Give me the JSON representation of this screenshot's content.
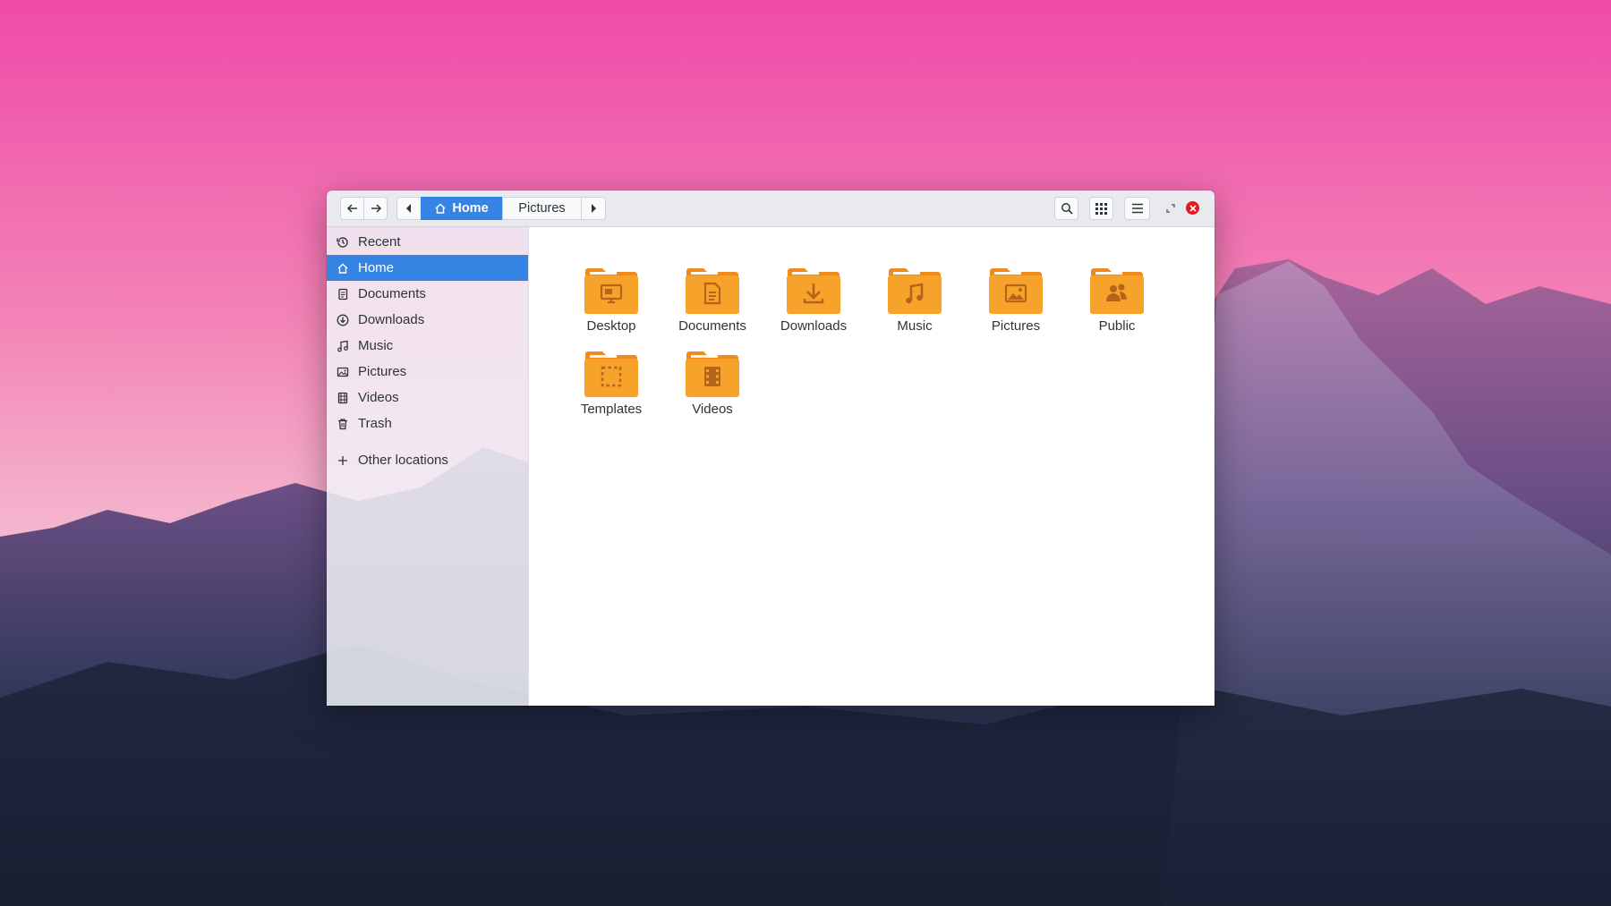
{
  "window": {
    "breadcrumbs": [
      {
        "label": "Home",
        "icon": "home-icon",
        "active": true
      },
      {
        "label": "Pictures",
        "icon": "",
        "active": false
      }
    ]
  },
  "sidebar": {
    "items": [
      {
        "label": "Recent",
        "icon": "clock-history-icon"
      },
      {
        "label": "Home",
        "icon": "home-icon",
        "active": true
      },
      {
        "label": "Documents",
        "icon": "document-icon"
      },
      {
        "label": "Downloads",
        "icon": "download-icon"
      },
      {
        "label": "Music",
        "icon": "music-note-icon"
      },
      {
        "label": "Pictures",
        "icon": "image-icon"
      },
      {
        "label": "Videos",
        "icon": "film-icon"
      },
      {
        "label": "Trash",
        "icon": "trash-icon"
      }
    ],
    "other_locations": {
      "label": "Other locations",
      "icon": "plus-icon"
    }
  },
  "files": [
    {
      "label": "Desktop",
      "icon": "folder-desktop-icon"
    },
    {
      "label": "Documents",
      "icon": "folder-documents-icon"
    },
    {
      "label": "Downloads",
      "icon": "folder-downloads-icon"
    },
    {
      "label": "Music",
      "icon": "folder-music-icon"
    },
    {
      "label": "Pictures",
      "icon": "folder-pictures-icon"
    },
    {
      "label": "Public",
      "icon": "folder-public-icon"
    },
    {
      "label": "Templates",
      "icon": "folder-templates-icon"
    },
    {
      "label": "Videos",
      "icon": "folder-videos-icon"
    }
  ],
  "colors": {
    "accent": "#3584e4",
    "folder": "#f7a22a",
    "folder_tab": "#f08a1c",
    "close": "#e01b24"
  }
}
